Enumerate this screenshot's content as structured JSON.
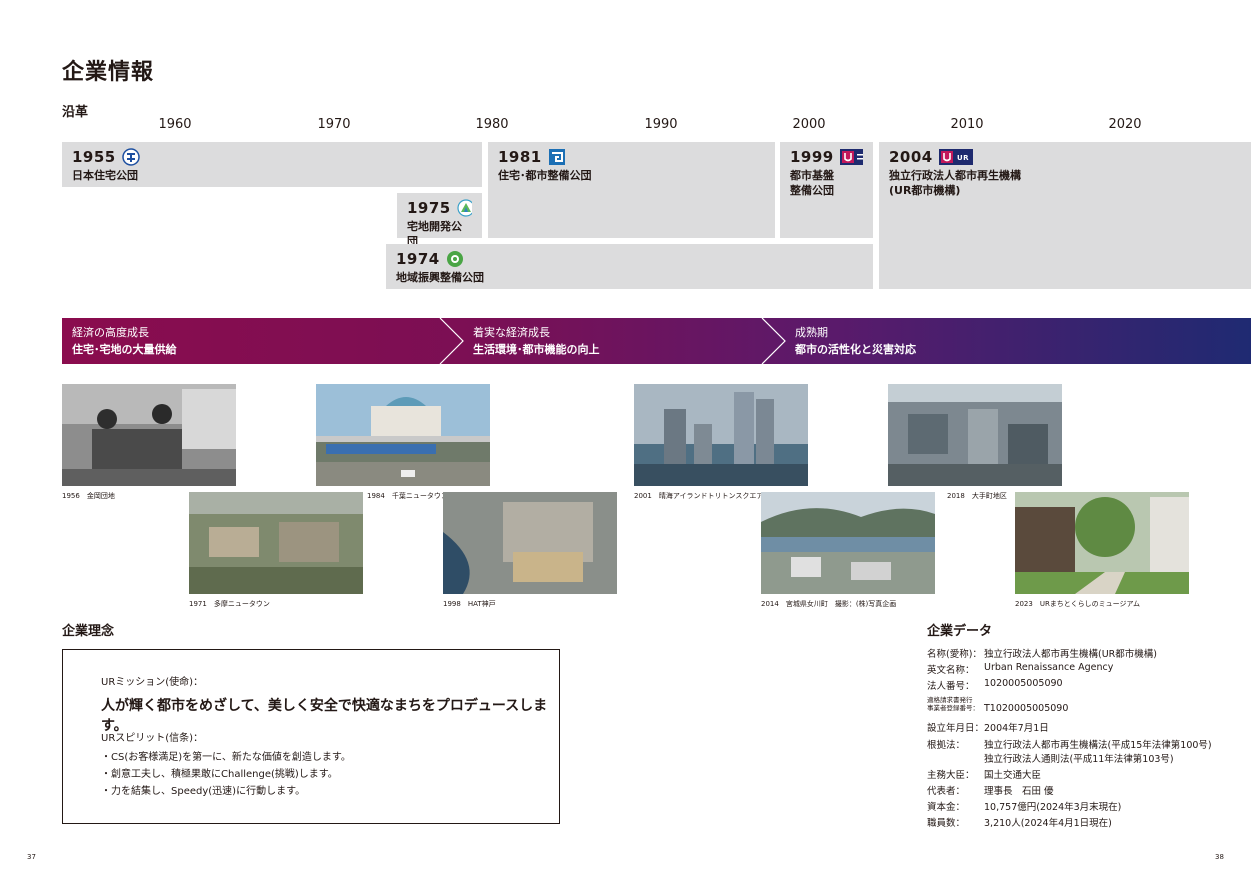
{
  "title": "企業情報",
  "history": {
    "heading": "沿革",
    "years": [
      "1960",
      "1970",
      "1980",
      "1990",
      "2000",
      "2010",
      "2020"
    ],
    "orgs": [
      {
        "year": "1955",
        "name": "日本住宅公団"
      },
      {
        "year": "1975",
        "name": "宅地開発公団"
      },
      {
        "year": "1974",
        "name": "地域振興整備公団"
      },
      {
        "year": "1981",
        "name": "住宅･都市整備公団"
      },
      {
        "year": "1999",
        "name": "都市基盤",
        "name2": "整備公団"
      },
      {
        "year": "2004",
        "name": "独立行政法人都市再生機構",
        "name2": "(UR都市機構)"
      }
    ]
  },
  "eras": [
    {
      "line1": "経済の高度成長",
      "line2": "住宅･宅地の大量供給"
    },
    {
      "line1": "着実な経済成長",
      "line2": "生活環境･都市機能の向上"
    },
    {
      "line1": "成熟期",
      "line2": "都市の活性化と災害対応"
    }
  ],
  "photos": [
    {
      "caption": "1956　金岡団地"
    },
    {
      "caption": "1984　千葉ニュータウン"
    },
    {
      "caption": "2001　晴海アイランドトリトンスクエア"
    },
    {
      "caption": "2018　大手町地区"
    },
    {
      "caption": "1971　多摩ニュータウン"
    },
    {
      "caption": "1998　HAT神戸"
    },
    {
      "caption": "2014　宮城県女川町　撮影：(株)写真企画"
    },
    {
      "caption": "2023　URまちとくらしのミュージアム"
    }
  ],
  "philosophy": {
    "heading": "企業理念",
    "mission_label": "URミッション(使命)：",
    "mission": "人が輝く都市をめざして、美しく安全で快適なまちをプロデュースします。",
    "spirit_label": "URスピリット(信条)：",
    "spirits": [
      "・CS(お客様満足)を第一に、新たな価値を創造します。",
      "・創意工夫し、積極果敢にChallenge(挑戦)します。",
      "・力を結集し、Speedy(迅速)に行動します。"
    ]
  },
  "company_data": {
    "heading": "企業データ",
    "rows": [
      {
        "label": "名称(愛称)：",
        "value": "独立行政法人都市再生機構(UR都市機構)"
      },
      {
        "label": "英文名称：",
        "value": "Urban Renaissance Agency"
      },
      {
        "label": "法人番号：",
        "value": "1020005005090"
      },
      {
        "label": "適格請求書発行",
        "label2": "事業者登録番号：",
        "value": "T1020005005090"
      },
      {
        "label": "設立年月日：",
        "value": "2004年7月1日"
      },
      {
        "label": "根拠法：",
        "value": "独立行政法人都市再生機構法(平成15年法律第100号)",
        "value2": "独立行政法人通則法(平成11年法律第103号)"
      },
      {
        "label": "主務大臣：",
        "value": "国土交通大臣"
      },
      {
        "label": "代表者：",
        "value": "理事長　石田 優"
      },
      {
        "label": "資本金：",
        "value": "10,757億円(2024年3月末現在)"
      },
      {
        "label": "職員数：",
        "value": "3,210人(2024年4月1日現在)"
      }
    ]
  },
  "page_numbers": {
    "left": "37",
    "right": "38"
  },
  "colors": {
    "band_start": "#8a0c4e",
    "band_end": "#1f2a72",
    "block": "#dcdcdd"
  }
}
